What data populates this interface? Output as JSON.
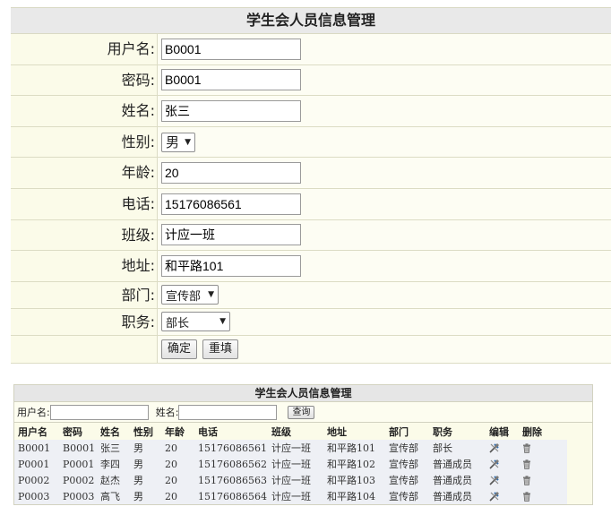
{
  "form": {
    "title": "学生会人员信息管理",
    "fields": {
      "username": {
        "label": "用户名:",
        "value": "B0001"
      },
      "password": {
        "label": "密码:",
        "value": "B0001"
      },
      "name": {
        "label": "姓名:",
        "value": "张三"
      },
      "gender": {
        "label": "性别:",
        "value": "男"
      },
      "age": {
        "label": "年龄:",
        "value": "20"
      },
      "phone": {
        "label": "电话:",
        "value": "15176086561"
      },
      "class": {
        "label": "班级:",
        "value": "计应一班"
      },
      "address": {
        "label": "地址:",
        "value": "和平路101"
      },
      "department": {
        "label": "部门:",
        "value": "宣传部"
      },
      "position": {
        "label": "职务:",
        "value": "部长"
      }
    },
    "buttons": {
      "submit": "确定",
      "reset": "重填"
    }
  },
  "list": {
    "title": "学生会人员信息管理",
    "search": {
      "username_label": "用户名:",
      "name_label": "姓名:",
      "button": "查询"
    },
    "columns": [
      "用户名",
      "密码",
      "姓名",
      "性别",
      "年龄",
      "电话",
      "班级",
      "地址",
      "部门",
      "职务",
      "编辑",
      "删除"
    ],
    "rows": [
      [
        "B0001",
        "B0001",
        "张三",
        "男",
        "20",
        "15176086561",
        "计应一班",
        "和平路101",
        "宣传部",
        "部长"
      ],
      [
        "P0001",
        "P0001",
        "李四",
        "男",
        "20",
        "15176086562",
        "计应一班",
        "和平路102",
        "宣传部",
        "普通成员"
      ],
      [
        "P0002",
        "P0002",
        "赵杰",
        "男",
        "20",
        "15176086563",
        "计应一班",
        "和平路103",
        "宣传部",
        "普通成员"
      ],
      [
        "P0003",
        "P0003",
        "高飞",
        "男",
        "20",
        "15176086564",
        "计应一班",
        "和平路104",
        "宣传部",
        "普通成员"
      ]
    ],
    "icons": {
      "edit": "edit-tools-icon",
      "delete": "trash-icon"
    }
  }
}
